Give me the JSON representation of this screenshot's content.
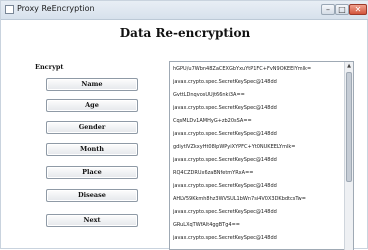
{
  "window": {
    "title": "Proxy ReEncryption",
    "minimize_glyph": "–",
    "maximize_glyph": "□",
    "close_glyph": "✕"
  },
  "main": {
    "heading": "Data Re-encryption",
    "section_label": "Encrypt"
  },
  "buttons": [
    "Name",
    "Age",
    "Gender",
    "Month",
    "Place",
    "Disease",
    "Next"
  ],
  "output": {
    "lines": [
      "hGPU/u7Wbn48ZaCEXGbYxuYtP1FC+FvN9OKEEIYmlk=",
      "javax.crypto.spec.SecretKeySpec@148dd",
      "GvttLDnqvosUUjt66nki3A==",
      "javax.crypto.spec.SecretKeySpec@148dd",
      "CqsMLDv1AMHyG+zb20sSA==",
      "javax.crypto.spec.SecretKeySpec@148dd",
      "gdiytlVZkxyHt08lpWPyiXYPFC+Yt0NUKEELYmlk=",
      "javax.crypto.spec.SecretKeySpec@148dd",
      "RQ4CZDRUx6zaBNfetmYRxA==",
      "javax.crypto.spec.SecretKeySpec@148dd",
      "AHLV59Kkmh8hz3WVSUL1bWn7si4V0X3DKbdtcsTw=",
      "javax.crypto.spec.SecretKeySpec@148dd",
      "GRuLXqTWfAlt4ggBTg4==",
      "javax.crypto.spec.SecretKeySpec@148dd"
    ],
    "scroll_up_glyph": "▲"
  },
  "colors": {
    "titlebar": "#d7e1ec",
    "close_button": "#d2553d",
    "button_border": "#8f9aa6"
  }
}
